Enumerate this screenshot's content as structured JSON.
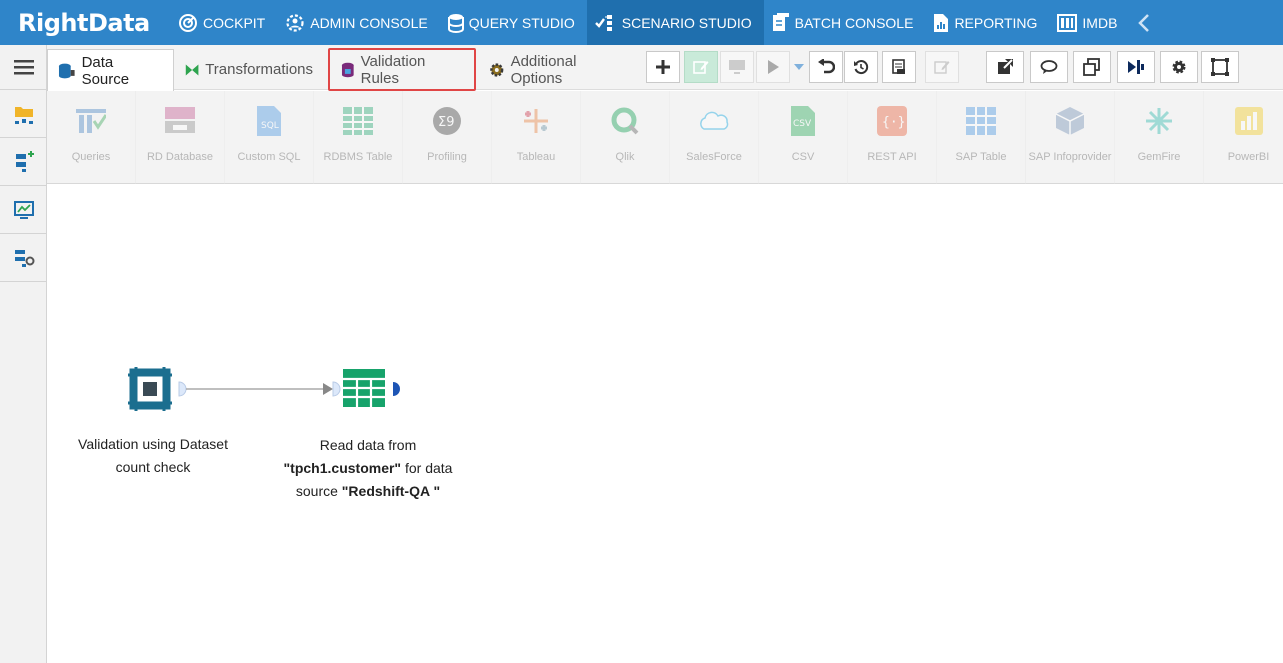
{
  "app": {
    "logo": "RightData"
  },
  "topnav": {
    "items": [
      {
        "label": "COCKPIT"
      },
      {
        "label": "ADMIN CONSOLE"
      },
      {
        "label": "QUERY STUDIO"
      },
      {
        "label": "SCENARIO STUDIO"
      },
      {
        "label": "BATCH CONSOLE"
      },
      {
        "label": "REPORTING"
      },
      {
        "label": "IMDB"
      }
    ],
    "active_index": 3,
    "accent": "#2f85c9"
  },
  "tabs": [
    {
      "label": "Data Source",
      "icon": "database-plug-icon",
      "active": true
    },
    {
      "label": "Transformations",
      "icon": "bowtie-icon",
      "active": false
    },
    {
      "label": "Validation Rules",
      "icon": "validation-db-icon",
      "active": false,
      "highlighted": true
    },
    {
      "label": "Additional Options",
      "icon": "gear-icon",
      "active": false
    }
  ],
  "palette": [
    {
      "label": "Queries",
      "icon": "queries-icon"
    },
    {
      "label": "RD Database",
      "icon": "rd-database-icon"
    },
    {
      "label": "Custom SQL",
      "icon": "custom-sql-icon"
    },
    {
      "label": "RDBMS Table",
      "icon": "rdbms-table-icon"
    },
    {
      "label": "Profiling",
      "icon": "profiling-icon"
    },
    {
      "label": "Tableau",
      "icon": "tableau-icon"
    },
    {
      "label": "Qlik",
      "icon": "qlik-icon"
    },
    {
      "label": "SalesForce",
      "icon": "salesforce-icon"
    },
    {
      "label": "CSV",
      "icon": "csv-icon"
    },
    {
      "label": "REST API",
      "icon": "rest-api-icon"
    },
    {
      "label": "SAP Table",
      "icon": "sap-table-icon"
    },
    {
      "label": "SAP Infoprovider",
      "icon": "sap-infoprovider-icon"
    },
    {
      "label": "GemFire",
      "icon": "gemfire-icon"
    },
    {
      "label": "PowerBI",
      "icon": "powerbi-icon"
    }
  ],
  "canvas": {
    "node1": {
      "label": "Validation using Dataset count check"
    },
    "node2": {
      "prefix": "Read data from ",
      "table": "\"tpch1.customer\"",
      "middle": " for data source ",
      "source": "\"Redshift-QA \""
    }
  }
}
